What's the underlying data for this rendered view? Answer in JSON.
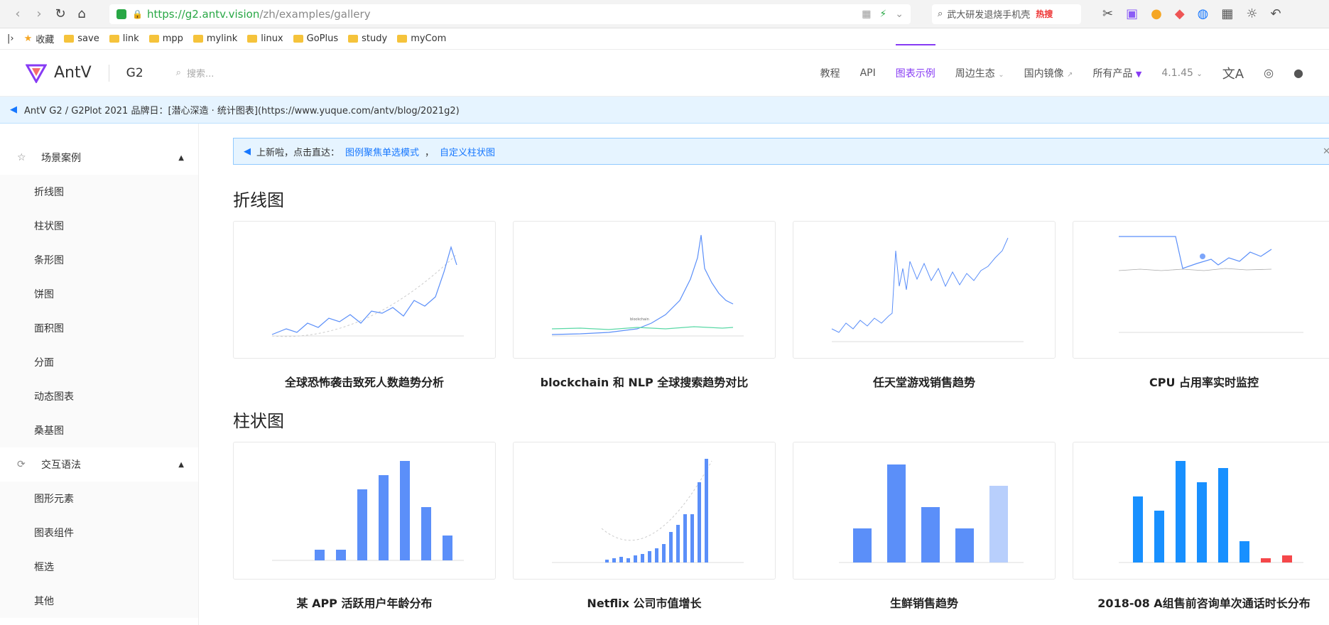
{
  "browser": {
    "url_host": "https://g2.antv.vision",
    "url_path": "/zh/examples/gallery",
    "search_text": "武大研发退烧手机壳",
    "search_badge": "热搜"
  },
  "bookmarks": [
    {
      "label": "收藏",
      "icon": "star-icon"
    },
    {
      "label": "save",
      "icon": "folder-icon"
    },
    {
      "label": "link",
      "icon": "folder-icon"
    },
    {
      "label": "mpp",
      "icon": "folder-icon"
    },
    {
      "label": "mylink",
      "icon": "folder-icon"
    },
    {
      "label": "linux",
      "icon": "folder-icon"
    },
    {
      "label": "GoPlus",
      "icon": "folder-icon"
    },
    {
      "label": "study",
      "icon": "folder-icon"
    },
    {
      "label": "myCom",
      "icon": "folder-icon"
    }
  ],
  "site": {
    "brand": "AntV",
    "product": "G2",
    "search_placeholder": "搜索...",
    "nav": [
      "教程",
      "API",
      "图表示例",
      "周边生态",
      "国内镜像",
      "所有产品",
      "4.1.45"
    ],
    "active_nav": "图表示例"
  },
  "banner": {
    "text": "AntV G2 / G2Plot 2021 品牌日：[潜心深造 · 统计图表](https://www.yuque.com/antv/blog/2021g2)"
  },
  "notice": {
    "prefix": "上新啦，点击直达：",
    "link1": "图例聚焦单选模式",
    "sep": "，",
    "link2": "自定义柱状图"
  },
  "sidebar": {
    "groups": [
      {
        "label": "场景案例",
        "icon": "star-outline-icon",
        "items": [
          "折线图",
          "柱状图",
          "条形图",
          "饼图",
          "面积图",
          "分面",
          "动态图表",
          "桑基图"
        ]
      },
      {
        "label": "交互语法",
        "icon": "sync-icon",
        "items": [
          "图形元素",
          "图表组件",
          "框选",
          "其他"
        ]
      }
    ]
  },
  "sections": [
    {
      "title": "折线图",
      "cards": [
        {
          "title": "全球恐怖袭击致死人数趋势分析"
        },
        {
          "title": "blockchain 和 NLP 全球搜索趋势对比"
        },
        {
          "title": "任天堂游戏销售趋势"
        },
        {
          "title": "CPU 占用率实时监控"
        }
      ]
    },
    {
      "title": "柱状图",
      "cards": [
        {
          "title": "某 APP 活跃用户年龄分布"
        },
        {
          "title": "Netflix 公司市值增长"
        },
        {
          "title": "生鲜销售趋势"
        },
        {
          "title": "2018-08 A组售前咨询单次通话时长分布"
        }
      ]
    }
  ],
  "colors": {
    "accent": "#873bf4",
    "chart_blue": "#5b8ff9",
    "chart_red": "#f5474a",
    "banner_bg": "#e6f4ff"
  }
}
